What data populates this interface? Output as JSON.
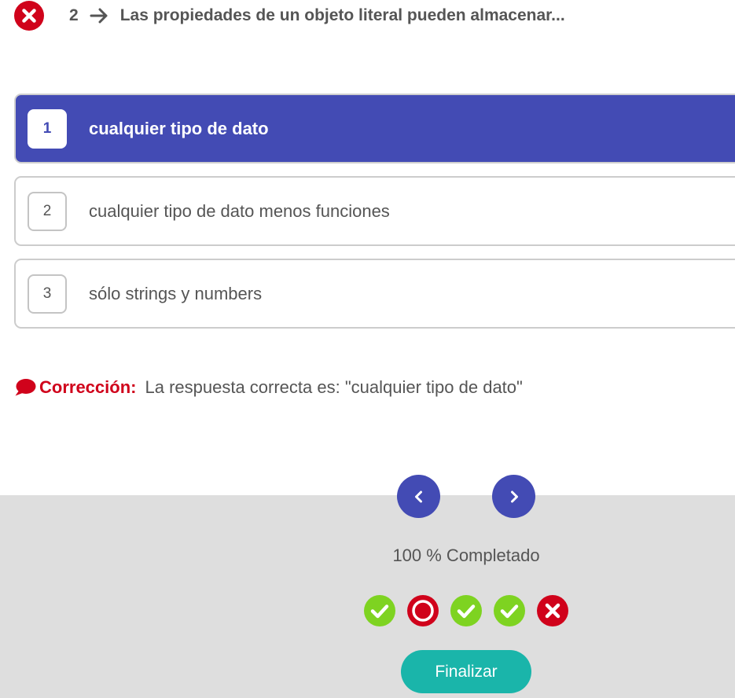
{
  "question": {
    "status": "incorrect",
    "status_icon": "x-circle-icon",
    "number": "2",
    "arrow_icon": "arrow-right-icon",
    "title": "Las propiedades de un objeto literal pueden almacenar..."
  },
  "options": [
    {
      "number": "1",
      "text": "cualquier tipo de dato",
      "selected": true
    },
    {
      "number": "2",
      "text": "cualquier tipo de dato menos funciones",
      "selected": false
    },
    {
      "number": "3",
      "text": "sólo strings y numbers",
      "selected": false
    }
  ],
  "correction": {
    "icon": "chat-bubble-icon",
    "label": "Corrección:",
    "text": "La respuesta correcta es: \"cualquier tipo de dato\""
  },
  "navigation": {
    "prev_icon": "chevron-left-icon",
    "next_icon": "chevron-right-icon"
  },
  "progress": {
    "text": "100 % Completado",
    "questions": [
      "correct",
      "current",
      "correct",
      "correct",
      "incorrect"
    ]
  },
  "finish_label": "Finalizar",
  "colors": {
    "primary": "#434bb4",
    "error": "#d0021b",
    "success": "#7ed321",
    "teal": "#1ab5aa",
    "footer_bg": "#dedede"
  }
}
